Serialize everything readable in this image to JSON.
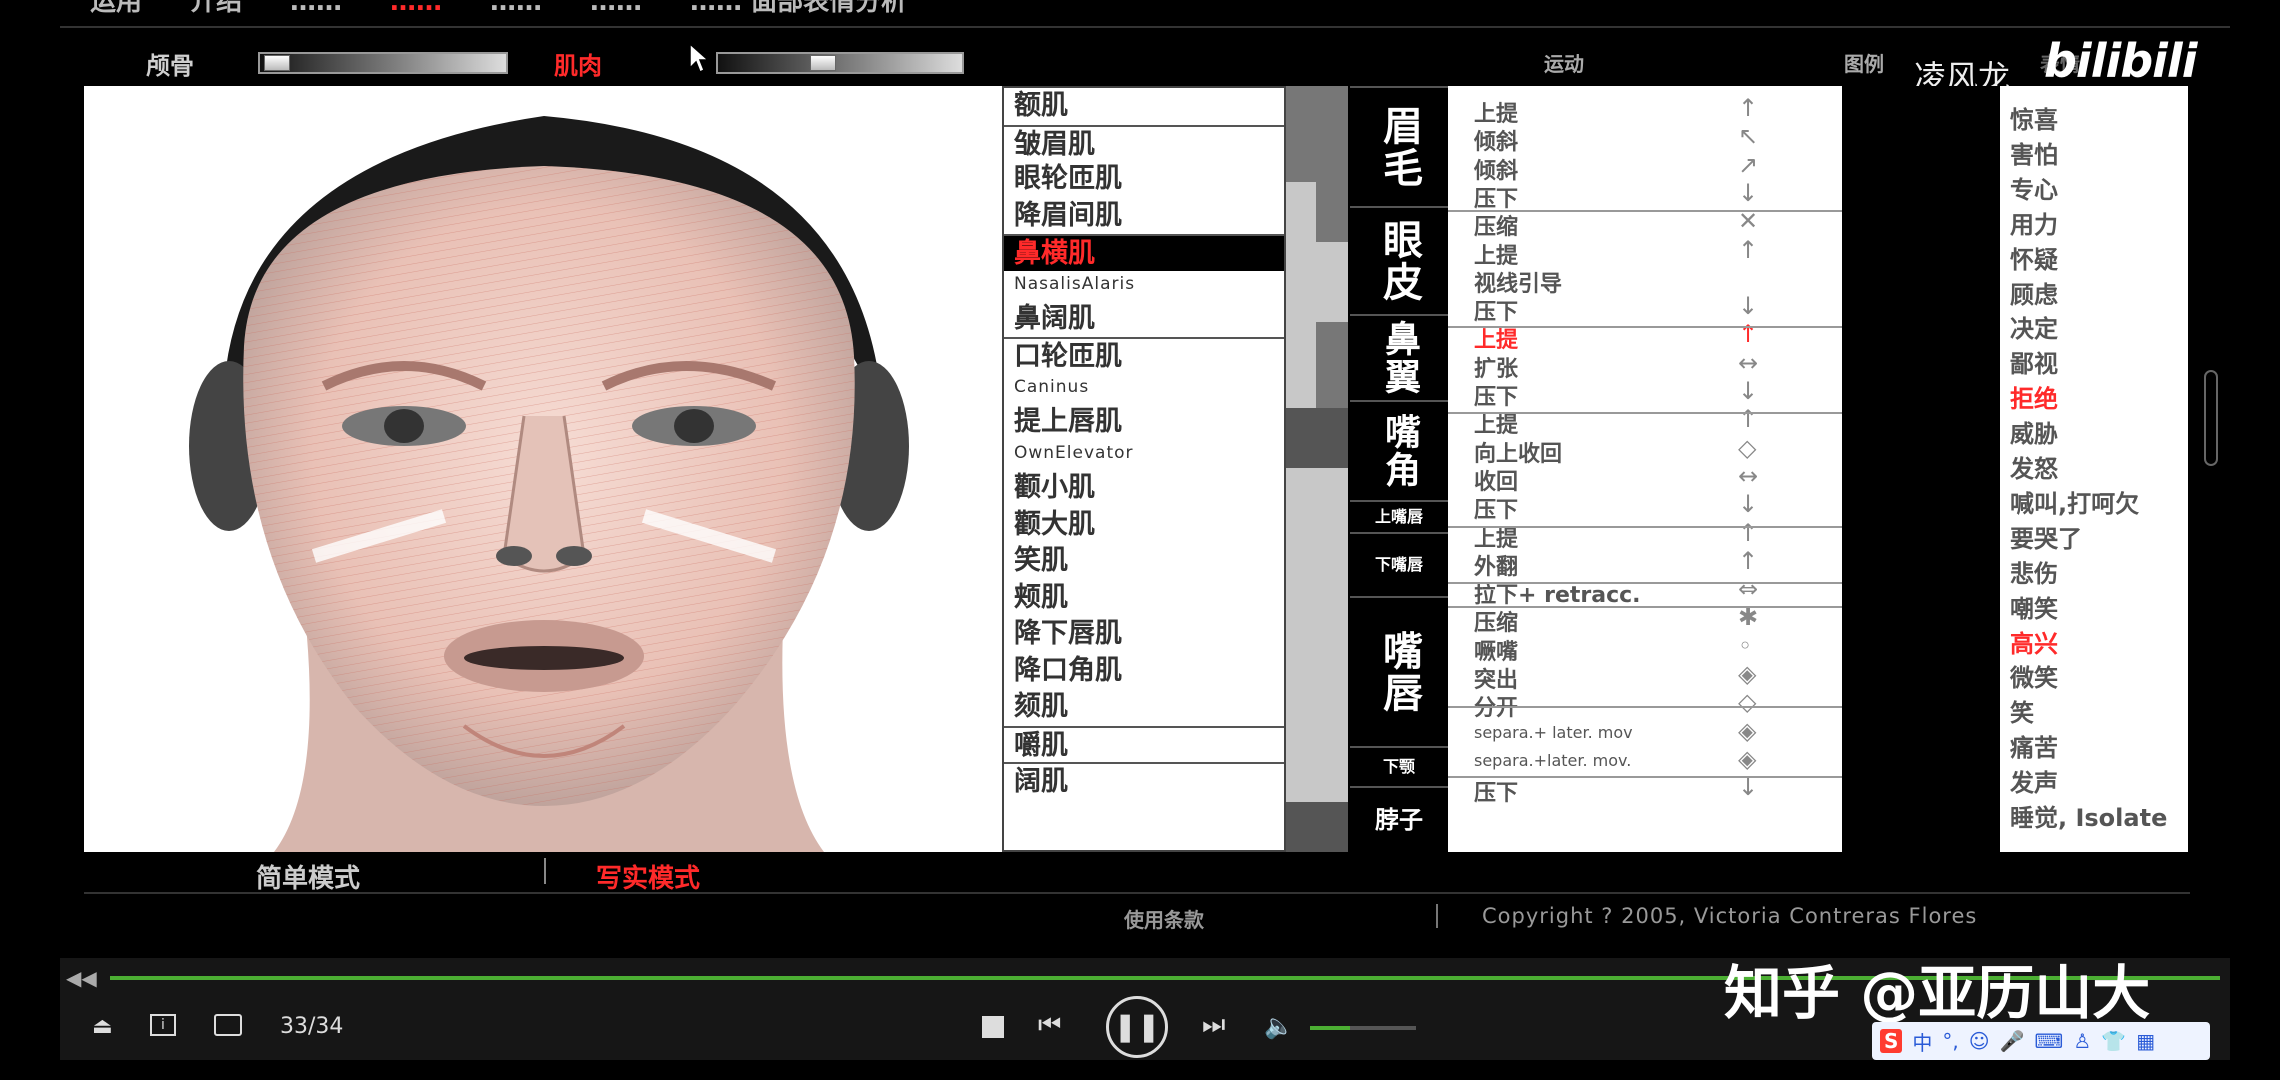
{
  "top_menu_partial": [
    "运用",
    "介绍",
    "……",
    "……",
    "……",
    "……",
    "……  面部表情分析"
  ],
  "toolbar": {
    "bone_label": "颅骨",
    "muscle_label": "肌肉",
    "motion_header": "运动",
    "legend_header": "图例",
    "expression_header": "表情"
  },
  "uploader": {
    "name": "凌风龙",
    "platform": "bilibili"
  },
  "muscles": [
    {
      "label": "额肌",
      "small": false,
      "sep": false,
      "sel": false
    },
    {
      "label": "皱眉肌",
      "small": false,
      "sep": true,
      "sel": false
    },
    {
      "label": "眼轮匝肌",
      "small": false,
      "sep": false,
      "sel": false
    },
    {
      "label": "降眉间肌",
      "small": false,
      "sep": false,
      "sel": false
    },
    {
      "label": "鼻横肌",
      "small": false,
      "sep": true,
      "sel": true
    },
    {
      "label": "NasalisAlaris",
      "small": true,
      "sep": false,
      "sel": false
    },
    {
      "label": "鼻阔肌",
      "small": false,
      "sep": false,
      "sel": false
    },
    {
      "label": "口轮匝肌",
      "small": false,
      "sep": true,
      "sel": false
    },
    {
      "label": "Caninus",
      "small": true,
      "sep": false,
      "sel": false
    },
    {
      "label": "提上唇肌",
      "small": false,
      "sep": false,
      "sel": false
    },
    {
      "label": "OwnElevator",
      "small": true,
      "sep": false,
      "sel": false
    },
    {
      "label": "颧小肌",
      "small": false,
      "sep": false,
      "sel": false
    },
    {
      "label": "颧大肌",
      "small": false,
      "sep": false,
      "sel": false
    },
    {
      "label": "笑肌",
      "small": false,
      "sep": false,
      "sel": false
    },
    {
      "label": "颊肌",
      "small": false,
      "sep": false,
      "sel": false
    },
    {
      "label": "降下唇肌",
      "small": false,
      "sep": false,
      "sel": false
    },
    {
      "label": "降口角肌",
      "small": false,
      "sep": false,
      "sel": false
    },
    {
      "label": "颏肌",
      "small": false,
      "sep": false,
      "sel": false
    },
    {
      "label": "嚼肌",
      "small": false,
      "sep": true,
      "sel": false
    },
    {
      "label": "阔肌",
      "small": false,
      "sep": true,
      "sel": false
    }
  ],
  "groups": [
    "眉毛",
    "眼皮",
    "鼻翼",
    "嘴角",
    "上嘴唇",
    "下嘴唇",
    "嘴唇",
    "下颚",
    "脖子"
  ],
  "motions": [
    {
      "label": "上提",
      "red": false,
      "small": false,
      "arrow": "↑"
    },
    {
      "label": "倾斜",
      "red": false,
      "small": false,
      "arrow": "↖"
    },
    {
      "label": "倾斜",
      "red": false,
      "small": false,
      "arrow": "↗"
    },
    {
      "label": "压下",
      "red": false,
      "small": false,
      "arrow": "↓"
    },
    {
      "label": "压缩",
      "red": false,
      "small": false,
      "arrow": "✕"
    },
    {
      "label": "上提",
      "red": false,
      "small": false,
      "arrow": "↑"
    },
    {
      "label": "视线引导",
      "red": false,
      "small": false,
      "arrow": ""
    },
    {
      "label": "压下",
      "red": false,
      "small": false,
      "arrow": "↓"
    },
    {
      "label": "上提",
      "red": true,
      "small": false,
      "arrow": "↑"
    },
    {
      "label": "扩张",
      "red": false,
      "small": false,
      "arrow": "↔"
    },
    {
      "label": "压下",
      "red": false,
      "small": false,
      "arrow": "↓"
    },
    {
      "label": "上提",
      "red": false,
      "small": false,
      "arrow": "↑"
    },
    {
      "label": "向上收回",
      "red": false,
      "small": false,
      "arrow": "◇"
    },
    {
      "label": "收回",
      "red": false,
      "small": false,
      "arrow": "↔"
    },
    {
      "label": "压下",
      "red": false,
      "small": false,
      "arrow": "↓"
    },
    {
      "label": "上提",
      "red": false,
      "small": false,
      "arrow": "↑"
    },
    {
      "label": "外翻",
      "red": false,
      "small": false,
      "arrow": "↑"
    },
    {
      "label": "拉下+ retracc.",
      "red": false,
      "small": false,
      "arrow": "⇔"
    },
    {
      "label": "压缩",
      "red": false,
      "small": false,
      "arrow": "✱"
    },
    {
      "label": "噘嘴",
      "red": false,
      "small": false,
      "arrow": "◦"
    },
    {
      "label": "突出",
      "red": false,
      "small": false,
      "arrow": "◈"
    },
    {
      "label": "分开",
      "red": false,
      "small": false,
      "arrow": "◇"
    },
    {
      "label": "separa.+ later. mov",
      "red": false,
      "small": true,
      "arrow": "◈"
    },
    {
      "label": "separa.+later. mov.",
      "red": false,
      "small": true,
      "arrow": "◈"
    },
    {
      "label": "压下",
      "red": false,
      "small": false,
      "arrow": "↓"
    }
  ],
  "emotions": [
    {
      "label": "惊喜",
      "red": false
    },
    {
      "label": "害怕",
      "red": false
    },
    {
      "label": "专心",
      "red": false
    },
    {
      "label": "用力",
      "red": false
    },
    {
      "label": "怀疑",
      "red": false
    },
    {
      "label": "顾虑",
      "red": false
    },
    {
      "label": "决定",
      "red": false
    },
    {
      "label": "鄙视",
      "red": false
    },
    {
      "label": "拒绝",
      "red": true
    },
    {
      "label": "威胁",
      "red": false
    },
    {
      "label": "发怒",
      "red": false
    },
    {
      "label": "喊叫,打呵欠",
      "red": false
    },
    {
      "label": "要哭了",
      "red": false
    },
    {
      "label": "悲伤",
      "red": false
    },
    {
      "label": "嘲笑",
      "red": false
    },
    {
      "label": "高兴",
      "red": true
    },
    {
      "label": "微笑",
      "red": false
    },
    {
      "label": "笑",
      "red": false
    },
    {
      "label": "痛苦",
      "red": false
    },
    {
      "label": "发声",
      "red": false
    },
    {
      "label": "睡觉, Isolate",
      "red": false
    }
  ],
  "modes": {
    "simple": "简单模式",
    "realistic": "写实模式"
  },
  "footer": {
    "terms": "使用条款",
    "copyright": "Copyright ? 2005, Victoria Contreras Flores"
  },
  "player": {
    "page": "33/34",
    "watermark": "知乎 @亚历山大",
    "volume_level": 0.38
  },
  "colors": {
    "accent_red": "#ff2a2a",
    "progress_green": "#4caf33"
  }
}
